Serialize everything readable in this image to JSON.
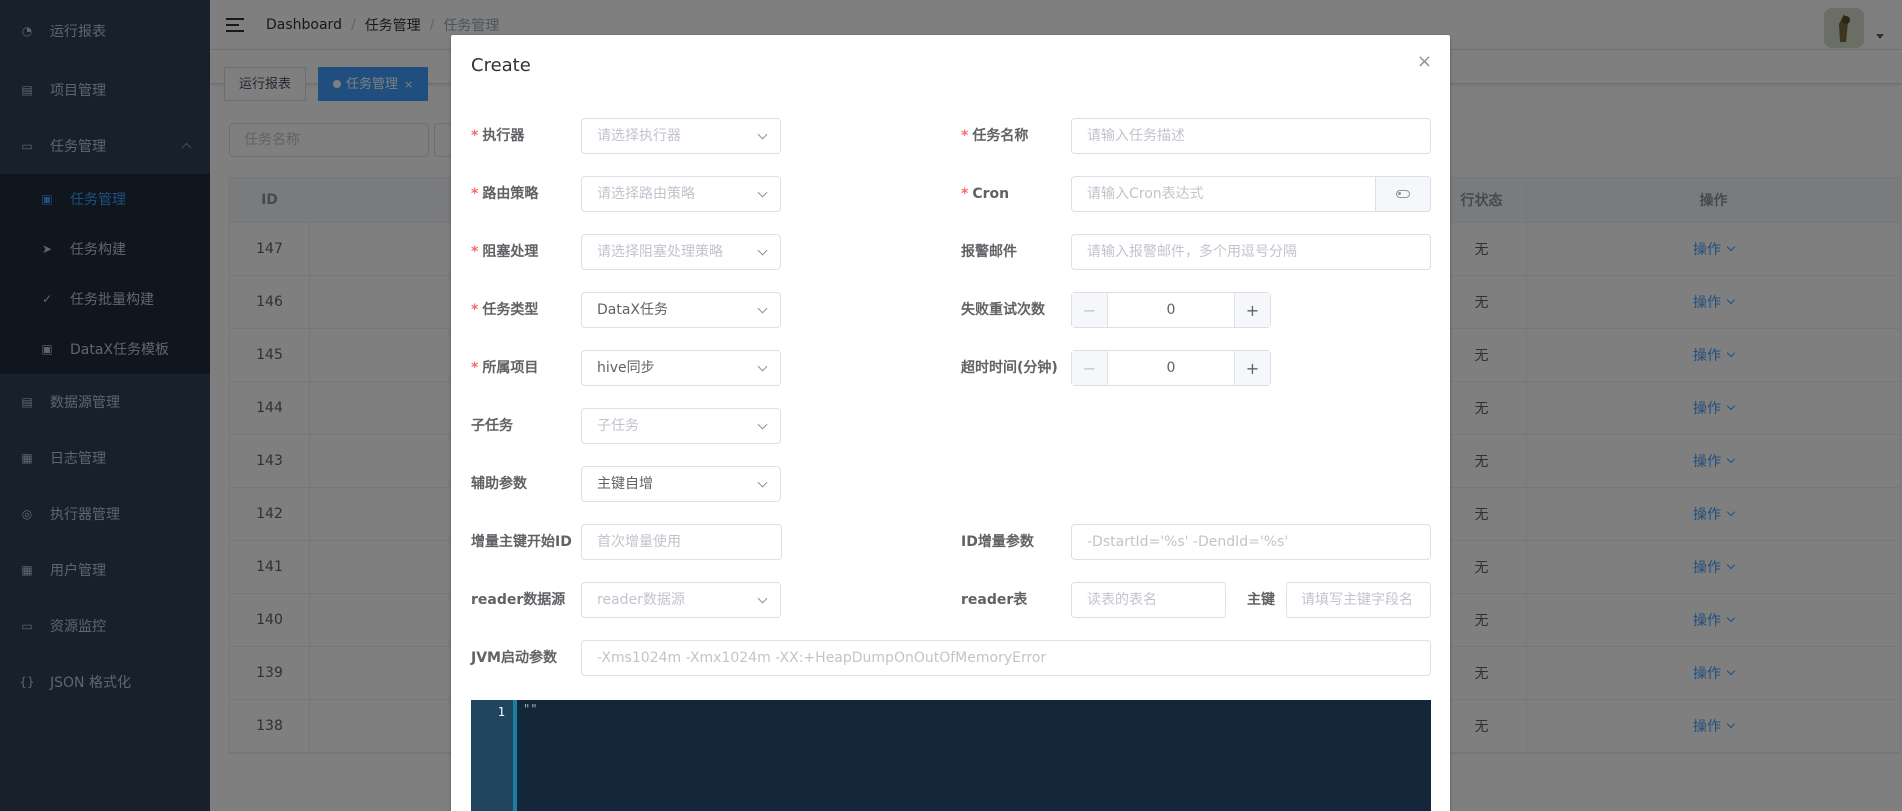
{
  "sidebar": {
    "items": [
      {
        "label": "运行报表",
        "icon": "dashboard-icon"
      },
      {
        "label": "项目管理",
        "icon": "database-icon"
      },
      {
        "label": "任务管理",
        "icon": "monitor-icon"
      },
      {
        "label": "数据源管理",
        "icon": "database-icon"
      },
      {
        "label": "日志管理",
        "icon": "document-icon"
      },
      {
        "label": "执行器管理",
        "icon": "eye-icon"
      },
      {
        "label": "用户管理",
        "icon": "grid-icon"
      },
      {
        "label": "资源监控",
        "icon": "monitor-icon"
      },
      {
        "label": "JSON 格式化",
        "icon": "braces-icon"
      }
    ],
    "submenu": [
      {
        "label": "任务管理",
        "icon": "clipboard-icon"
      },
      {
        "label": "任务构建",
        "icon": "paper-plane-icon"
      },
      {
        "label": "任务批量构建",
        "icon": "check-circle-icon"
      },
      {
        "label": "DataX任务模板",
        "icon": "clipboard-icon"
      }
    ]
  },
  "navbar": {
    "breadcrumb": [
      "Dashboard",
      "任务管理",
      "任务管理"
    ]
  },
  "tags": [
    {
      "label": "运行报表"
    },
    {
      "label": "任务管理",
      "close": "×"
    }
  ],
  "search": {
    "placeholder": "任务名称"
  },
  "table": {
    "headers": {
      "id": "ID",
      "status": "行状态",
      "op": "操作"
    },
    "rows": [
      {
        "id": "147",
        "status": "无",
        "op": "操作"
      },
      {
        "id": "146",
        "status": "无",
        "op": "操作"
      },
      {
        "id": "145",
        "status": "无",
        "op": "操作"
      },
      {
        "id": "144",
        "status": "无",
        "op": "操作"
      },
      {
        "id": "143",
        "status": "无",
        "op": "操作"
      },
      {
        "id": "142",
        "status": "无",
        "op": "操作"
      },
      {
        "id": "141",
        "status": "无",
        "op": "操作"
      },
      {
        "id": "140",
        "status": "无",
        "op": "操作"
      },
      {
        "id": "139",
        "status": "无",
        "op": "操作"
      },
      {
        "id": "138",
        "status": "无",
        "op": "操作"
      }
    ]
  },
  "dialog": {
    "title": "Create",
    "close": "×",
    "fields": {
      "executor": {
        "label": "执行器",
        "placeholder": "请选择执行器"
      },
      "task_name": {
        "label": "任务名称",
        "placeholder": "请输入任务描述"
      },
      "route": {
        "label": "路由策略",
        "placeholder": "请选择路由策略"
      },
      "cron": {
        "label": "Cron",
        "placeholder": "请输入Cron表达式"
      },
      "block": {
        "label": "阻塞处理",
        "placeholder": "请选择阻塞处理策略"
      },
      "alarm_email": {
        "label": "报警邮件",
        "placeholder": "请输入报警邮件，多个用逗号分隔"
      },
      "task_type": {
        "label": "任务类型",
        "value": "DataX任务"
      },
      "retry": {
        "label": "失败重试次数",
        "value": "0"
      },
      "project": {
        "label": "所属项目",
        "value": "hive同步"
      },
      "timeout": {
        "label": "超时时间(分钟)",
        "value": "0"
      },
      "child_task": {
        "label": "子任务",
        "placeholder": "子任务"
      },
      "aux_param": {
        "label": "辅助参数",
        "value": "主键自增"
      },
      "incr_start_id": {
        "label": "增量主键开始ID",
        "placeholder": "首次增量使用"
      },
      "id_incr_param": {
        "label": "ID增量参数",
        "placeholder": "-DstartId='%s' -DendId='%s'"
      },
      "reader_source": {
        "label": "reader数据源",
        "placeholder": "reader数据源"
      },
      "reader_table": {
        "label": "reader表",
        "placeholder": "读表的表名"
      },
      "primary_key": {
        "label": "主键",
        "placeholder": "请填写主键字段名"
      },
      "jvm": {
        "label": "JVM启动参数",
        "placeholder": "-Xms1024m -Xmx1024m -XX:+HeapDumpOnOutOfMemoryError"
      }
    },
    "editor": {
      "line": "1",
      "content": "\"\""
    }
  },
  "colors": {
    "sidebar_bg": "#304156",
    "accent": "#409eff",
    "required": "#f56c6c"
  }
}
